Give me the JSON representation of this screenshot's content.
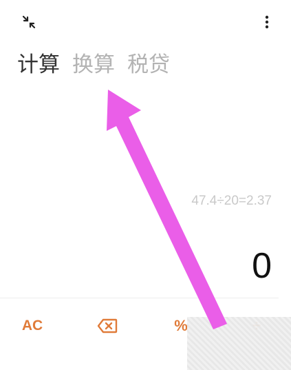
{
  "tabs": [
    {
      "label": "计算",
      "active": true
    },
    {
      "label": "换算",
      "active": false
    },
    {
      "label": "税贷",
      "active": false
    }
  ],
  "display": {
    "history": "47.4÷20=2.37",
    "value": "0"
  },
  "keys": {
    "ac": "AC",
    "percent": "%",
    "divide": "÷"
  },
  "colors": {
    "accent": "#e07b39",
    "arrow": "#ea5ee8",
    "active_tab": "#333333",
    "inactive_tab": "#b3b3b3"
  },
  "icons": {
    "collapse": "collapse-icon",
    "more": "more-vertical-icon",
    "backspace": "backspace-icon"
  }
}
